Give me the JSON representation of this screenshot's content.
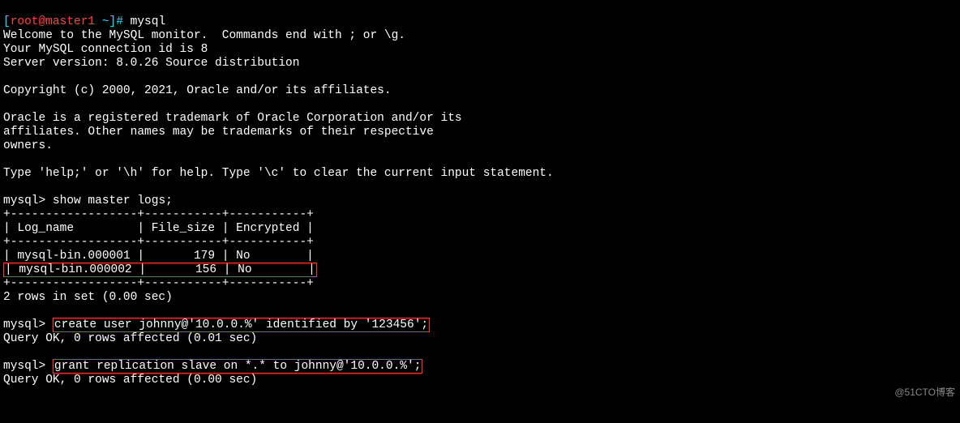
{
  "prompt": {
    "lb": "[",
    "user": "root@master1",
    "tilde": " ~",
    "rb": "]# ",
    "cmd": "mysql"
  },
  "welcome": [
    "Welcome to the MySQL monitor.  Commands end with ; or \\g.",
    "Your MySQL connection id is 8",
    "Server version: 8.0.26 Source distribution",
    "",
    "Copyright (c) 2000, 2021, Oracle and/or its affiliates.",
    "",
    "Oracle is a registered trademark of Oracle Corporation and/or its",
    "affiliates. Other names may be trademarks of their respective",
    "owners.",
    "",
    "Type 'help;' or '\\h' for help. Type '\\c' to clear the current input statement.",
    ""
  ],
  "mysql_prompt": "mysql> ",
  "cmd1": "show master logs;",
  "table": {
    "sep": "+------------------+-----------+-----------+",
    "header": "| Log_name         | File_size | Encrypted |",
    "rows": [
      "| mysql-bin.000001 |       179 | No        |",
      "| mysql-bin.000002 |       156 | No        |"
    ],
    "footer": "2 rows in set (0.00 sec)"
  },
  "cmd2": "create user johnny@'10.0.0.%' identified by '123456';",
  "res2": "Query OK, 0 rows affected (0.01 sec)",
  "cmd3": "grant replication slave on *.* to johnny@'10.0.0.%';",
  "res3": "Query OK, 0 rows affected (0.00 sec)",
  "watermark": "@51CTO博客"
}
